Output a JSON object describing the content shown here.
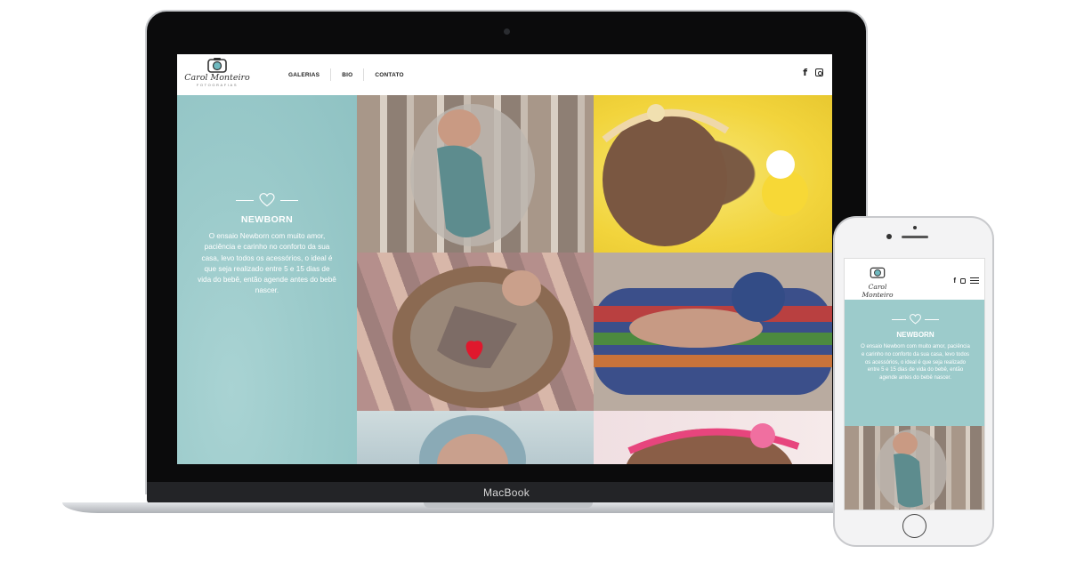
{
  "laptop": {
    "brand_label": "MacBook"
  },
  "site": {
    "logo": {
      "name": "Carol Monteiro",
      "subtitle": "FOTOGRAFIAS",
      "icon": "camera-icon"
    },
    "nav": [
      {
        "label": "GALERIAS"
      },
      {
        "label": "BIO"
      },
      {
        "label": "CONTATO"
      }
    ],
    "social": [
      {
        "icon": "facebook-icon",
        "glyph": "f"
      },
      {
        "icon": "instagram-icon"
      }
    ],
    "panel": {
      "icon": "heart-icon",
      "title": "NEWBORN",
      "description": "O ensaio Newborn com muito amor, paciência e carinho no conforto da sua casa, levo todos os acessórios, o ideal é que seja realizado entre 5 e 15 dias de vida do bebê, então agende antes do bebê nascer."
    },
    "gallery": [
      {
        "alt": "newborn wrapped in teal on wooden floor"
      },
      {
        "alt": "newborn with flower headband on yellow blanket"
      },
      {
        "alt": "newborn in basket with red heart"
      },
      {
        "alt": "newborn on striped knit blanket"
      },
      {
        "alt": "newborn with blue bonnet"
      },
      {
        "alt": "newborn with pink headband"
      }
    ]
  },
  "phone": {
    "menu_icon": "hamburger-menu-icon"
  },
  "colors": {
    "accent_teal": "#9ccbcb",
    "laptop_bezel": "#0b0b0c",
    "text_dark": "#222222"
  }
}
